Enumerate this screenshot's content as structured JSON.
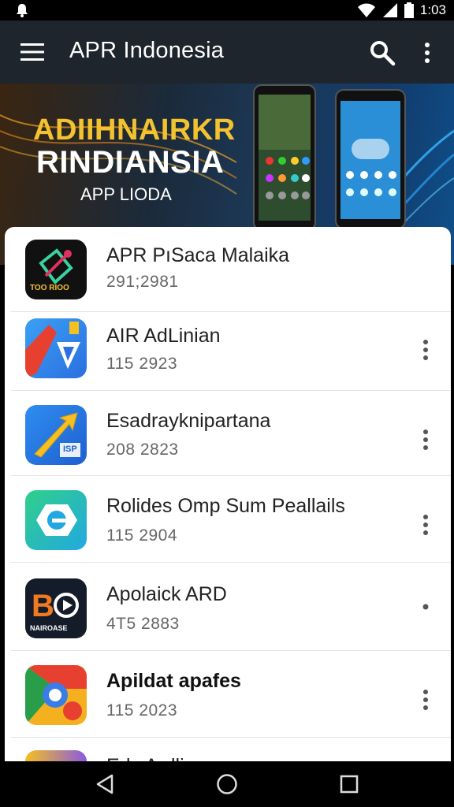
{
  "status_bar": {
    "time": "1:03"
  },
  "app_bar": {
    "title": "APR Indonesia"
  },
  "banner": {
    "line1": "ADIIHNAIRKR",
    "line2": "RINDIANSIA",
    "line3": "APP LIODA"
  },
  "apps": [
    {
      "name": "APR PıSaca Malaika",
      "meta": "291;2981",
      "icon_text": "TOO RIOO",
      "has_menu": false
    },
    {
      "name": "AIR AdLinian",
      "meta": "115  2923",
      "icon_text": "",
      "has_menu": true
    },
    {
      "name": "Esadrayknipartana",
      "meta": "208  2823",
      "icon_text": "ISP",
      "has_menu": true
    },
    {
      "name": "Rolides Omp Sum Peallails",
      "meta": "115  2904",
      "icon_text": "",
      "has_menu": true
    },
    {
      "name": "Apolaick ARD",
      "meta": "4T5  2883",
      "icon_text": "NAIROASE",
      "has_menu": false
    },
    {
      "name": "Apildat apafes",
      "meta": "115  2023",
      "icon_text": "",
      "has_menu": true
    },
    {
      "name": "Edy Ardli",
      "meta": "",
      "icon_text": "",
      "has_menu": false
    }
  ],
  "colors": {
    "app_bar": "#1e252c",
    "accent_yellow": "#f2c230"
  }
}
